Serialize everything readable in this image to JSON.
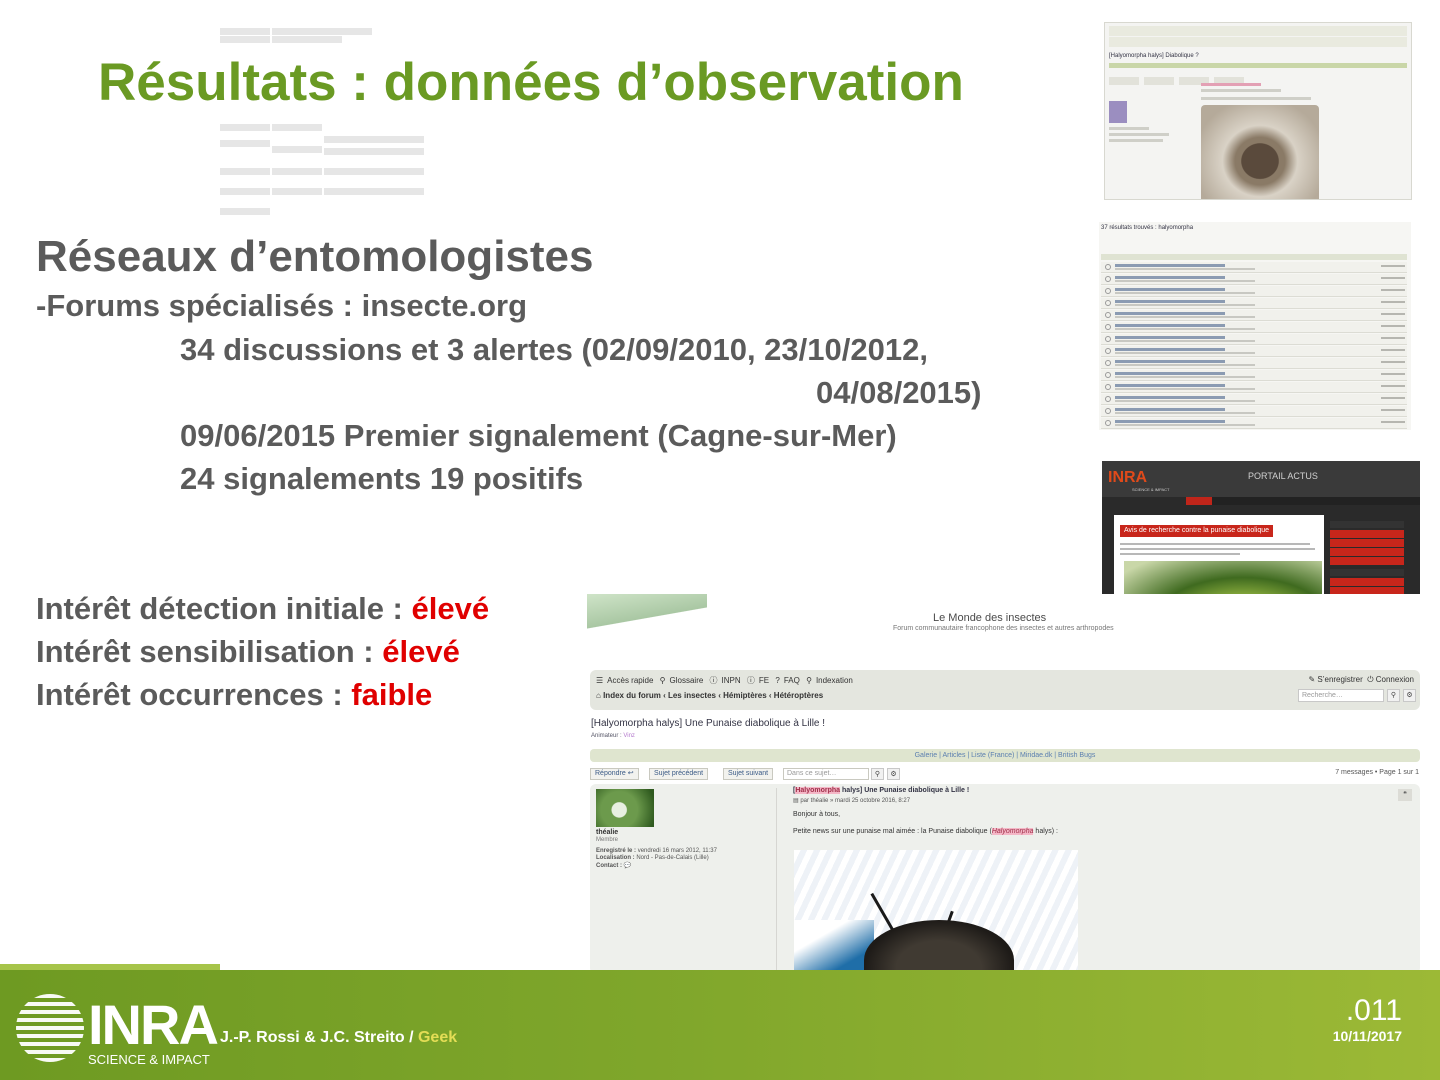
{
  "slide": {
    "title": "Résultats : données d’observation",
    "subheading": "Réseaux d’entomologistes",
    "lines": [
      "-Forums spécialisés : insecte.org",
      "34 discussions et 3 alertes (02/09/2010, 23/10/2012,",
      "04/08/2015)",
      "09/06/2015 Premier signalement (Cagne-sur-Mer)",
      "24 signalements 19 positifs"
    ],
    "interests": [
      {
        "label": "Intérêt détection initiale : ",
        "value": "élevé"
      },
      {
        "label": "Intérêt sensibilisation : ",
        "value": "élevé"
      },
      {
        "label": "Intérêt occurrences : ",
        "value": "faible"
      }
    ],
    "accent_color": "#6a9a23",
    "alert_color": "#e00000"
  },
  "screenshot_topic_small": {
    "title": "[Halyomorpha halys] Diabolique ?"
  },
  "screenshot_search": {
    "title": "37 résultats trouvés : halyomorpha"
  },
  "screenshot_portal": {
    "logo": "INRA",
    "logo_sub": "SCIENCE & IMPACT",
    "portal_title": "PORTAIL ACTUS",
    "headline": "Avis de recherche contre la punaise diabolique"
  },
  "screenshot_forum": {
    "site_name": "Le Monde des insectes",
    "site_tagline": "Forum communautaire francophone des insectes et autres arthropodes",
    "nav_items": [
      "Accès rapide",
      "Glossaire",
      "INPN",
      "FE",
      "FAQ",
      "Indexation"
    ],
    "register": "S’enregistrer",
    "login": "Connexion",
    "breadcrumb": "Index du forum ‹ Les insectes ‹ Hémiptères ‹ Hétéroptères",
    "search_placeholder": "Recherche…",
    "topic_title": "[Halyomorpha halys] Une Punaise diabolique à Lille !",
    "animator_label": "Animateur :",
    "animator_name": "Vinz",
    "links": "Galerie | Articles | Liste (France) | Miridae.dk | British Bugs",
    "reply_label": "Répondre",
    "prev_label": "Sujet précédent",
    "next_label": "Sujet suivant",
    "topic_search_placeholder": "Dans ce sujet…",
    "pagination": "7 messages • Page 1 sur 1",
    "post": {
      "username": "théalie",
      "role": "Membre",
      "registered_label": "Enregistré le :",
      "registered_value": "vendredi 16 mars 2012, 11:37",
      "location_label": "Localisation :",
      "location_value": "Nord - Pas-de-Calais (Lille)",
      "contact_label": "Contact :",
      "title_highlight": "Halyomorpha",
      "title_rest": "halys] Une Punaise diabolique à Lille !",
      "byline": "par théalie » mardi 25 octobre 2016, 8:27",
      "greeting": "Bonjour à tous,",
      "news_before": "Petite news sur une punaise mal aimée : la Punaise diabolique (",
      "news_highlight": "Halyomorpha",
      "news_after": " halys) :"
    }
  },
  "footer": {
    "logo": "INRA",
    "logo_sub": "SCIENCE & IMPACT",
    "authors": "J.-P. Rossi & J.C. Streito / ",
    "tag": "Geek",
    "slide_number": ".011",
    "date": "10/11/2017"
  }
}
